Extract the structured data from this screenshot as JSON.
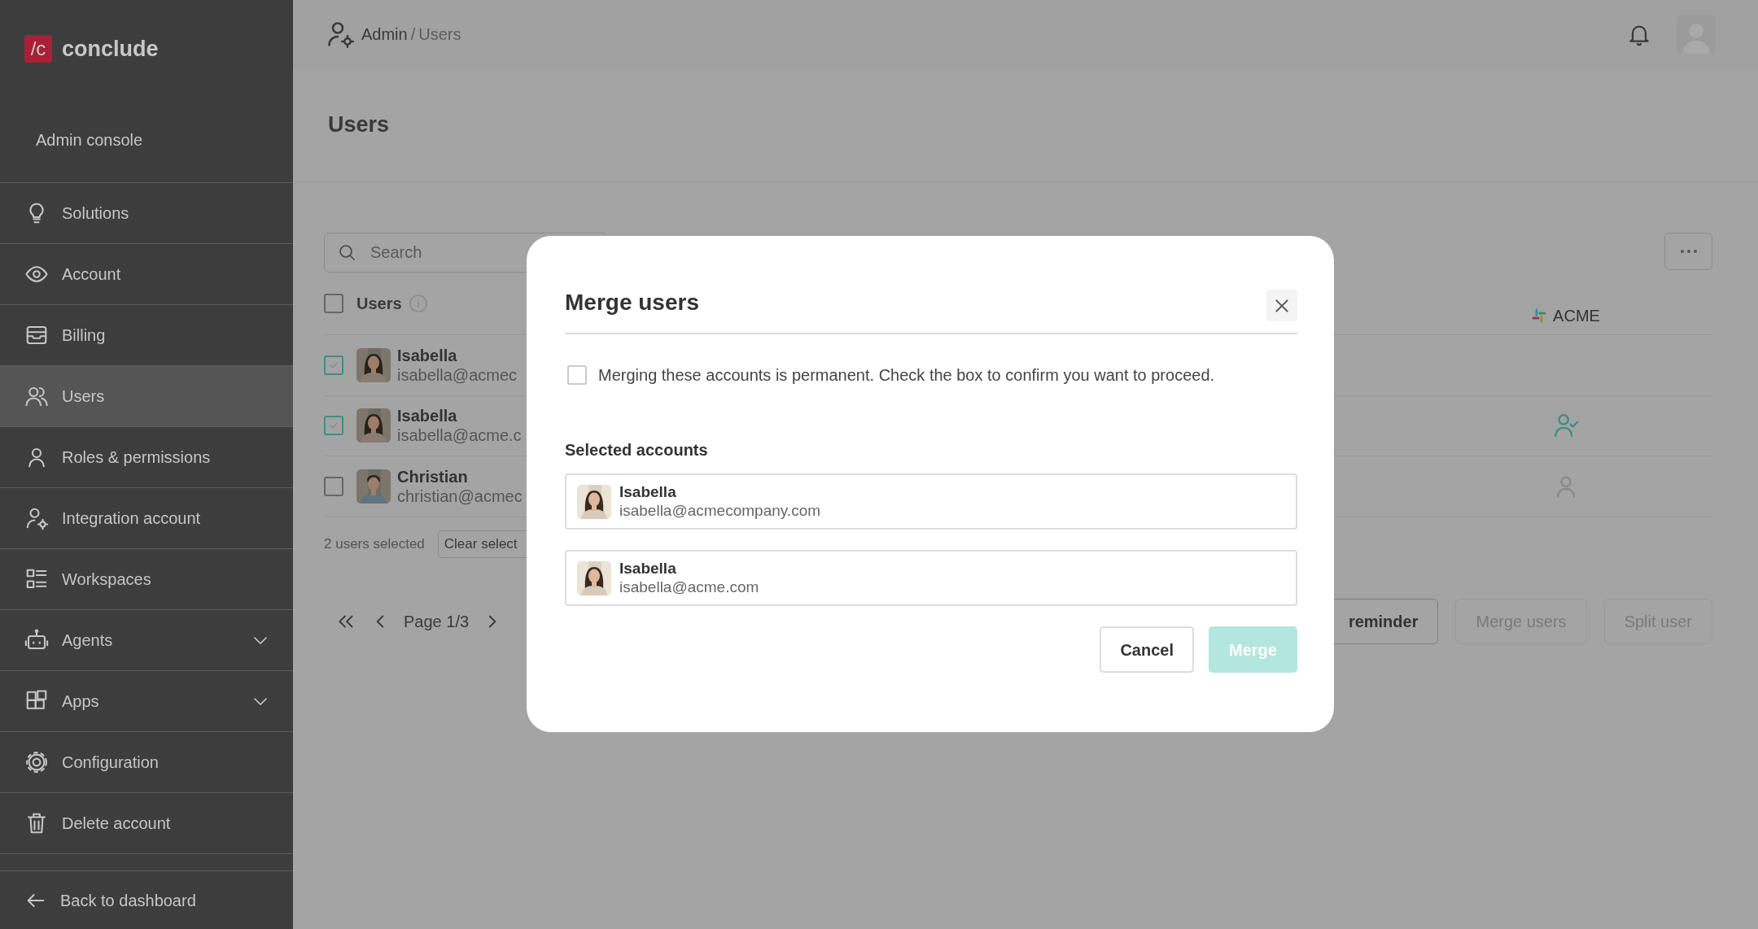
{
  "sidebar": {
    "logo": {
      "mark": "/c",
      "name": "conclude"
    },
    "section_title": "Admin console",
    "items": [
      {
        "label": "Solutions",
        "selected": false,
        "expandable": false
      },
      {
        "label": "Account",
        "selected": false,
        "expandable": false
      },
      {
        "label": "Billing",
        "selected": false,
        "expandable": false
      },
      {
        "label": "Users",
        "selected": true,
        "expandable": false
      },
      {
        "label": "Roles & permissions",
        "selected": false,
        "expandable": false
      },
      {
        "label": "Integration account",
        "selected": false,
        "expandable": false
      },
      {
        "label": "Workspaces",
        "selected": false,
        "expandable": false
      },
      {
        "label": "Agents",
        "selected": false,
        "expandable": true
      },
      {
        "label": "Apps",
        "selected": false,
        "expandable": true
      },
      {
        "label": "Configuration",
        "selected": false,
        "expandable": false
      },
      {
        "label": "Delete account",
        "selected": false,
        "expandable": false
      }
    ],
    "footer": {
      "label": "Back to dashboard"
    }
  },
  "header": {
    "breadcrumb": [
      {
        "label": "Admin",
        "current": false
      },
      {
        "label": "Users",
        "current": true
      }
    ],
    "separator": "/"
  },
  "page": {
    "title": "Users",
    "search": {
      "placeholder": "Search"
    },
    "table": {
      "header": {
        "label": "Users",
        "checked": false
      },
      "acme_column": "ACME",
      "rows": [
        {
          "name": "Isabella",
          "email": "isabella@acmec",
          "checked": true
        },
        {
          "name": "Isabella",
          "email": "isabella@acme.c",
          "checked": true,
          "acme": {
            "kind": "linked"
          }
        },
        {
          "name": "Christian",
          "email": "christian@acmec",
          "checked": false,
          "acme": {
            "kind": "unlinked"
          }
        }
      ]
    },
    "selection_text": "2 users selected",
    "clear_button": "Clear select",
    "pagination": {
      "label": "Page 1/3"
    },
    "actions": [
      {
        "label": "reminder",
        "disabled": false
      },
      {
        "label": "Merge users",
        "disabled": true
      },
      {
        "label": "Split user",
        "disabled": true
      }
    ]
  },
  "modal": {
    "title": "Merge users",
    "confirm": {
      "label": "Merging these accounts is permanent. Check the box to confirm you want to proceed.",
      "checked": false
    },
    "section_label": "Selected accounts",
    "accounts": [
      {
        "name": "Isabella",
        "email": "isabella@acmecompany.com"
      },
      {
        "name": "Isabella",
        "email": "isabella@acme.com"
      }
    ],
    "buttons": [
      {
        "label": "Cancel",
        "kind": "secondary",
        "disabled": false
      },
      {
        "label": "Merge",
        "kind": "primary",
        "disabled": true
      }
    ]
  }
}
